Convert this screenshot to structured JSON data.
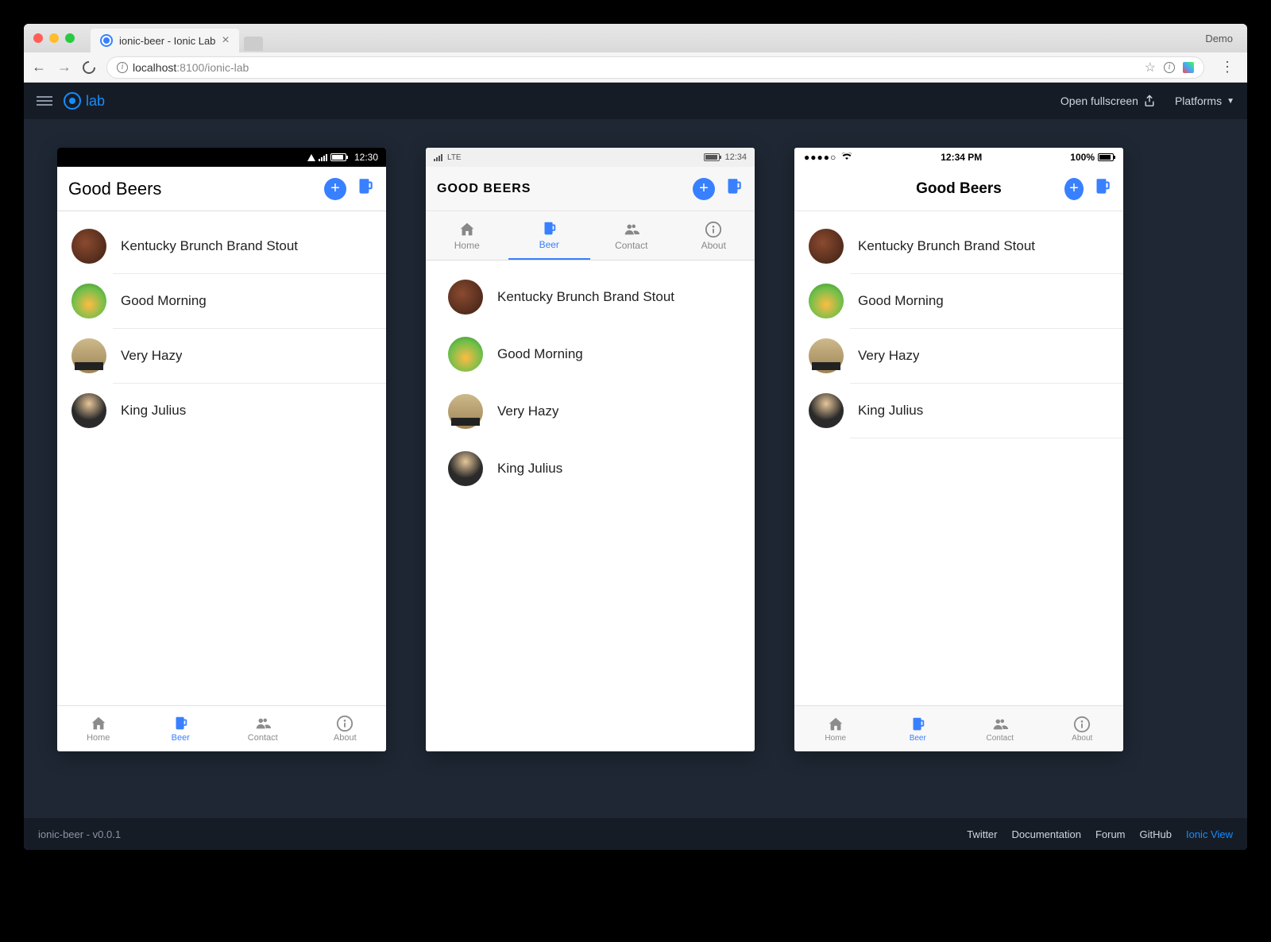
{
  "browser": {
    "tab_title": "ionic-beer - Ionic Lab",
    "demo_label": "Demo",
    "url_host": "localhost",
    "url_port": ":8100",
    "url_path": "/ionic-lab"
  },
  "lab_header": {
    "logo_text": "lab",
    "open_fullscreen": "Open fullscreen",
    "platforms": "Platforms"
  },
  "app": {
    "title": "Good Beers",
    "title_upper": "GOOD BEERS"
  },
  "android_status": {
    "time": "12:30"
  },
  "windows_status": {
    "carrier": "LTE",
    "time": "12:34"
  },
  "ios_status": {
    "time": "12:34 PM",
    "battery": "100%"
  },
  "tabs": {
    "home": "Home",
    "beer": "Beer",
    "contact": "Contact",
    "about": "About"
  },
  "beers": [
    {
      "name": "Kentucky Brunch Brand Stout"
    },
    {
      "name": "Good Morning"
    },
    {
      "name": "Very Hazy"
    },
    {
      "name": "King Julius"
    }
  ],
  "footer": {
    "version": "ionic-beer - v0.0.1",
    "links": {
      "twitter": "Twitter",
      "documentation": "Documentation",
      "forum": "Forum",
      "github": "GitHub",
      "ionic_view": "Ionic View"
    }
  }
}
